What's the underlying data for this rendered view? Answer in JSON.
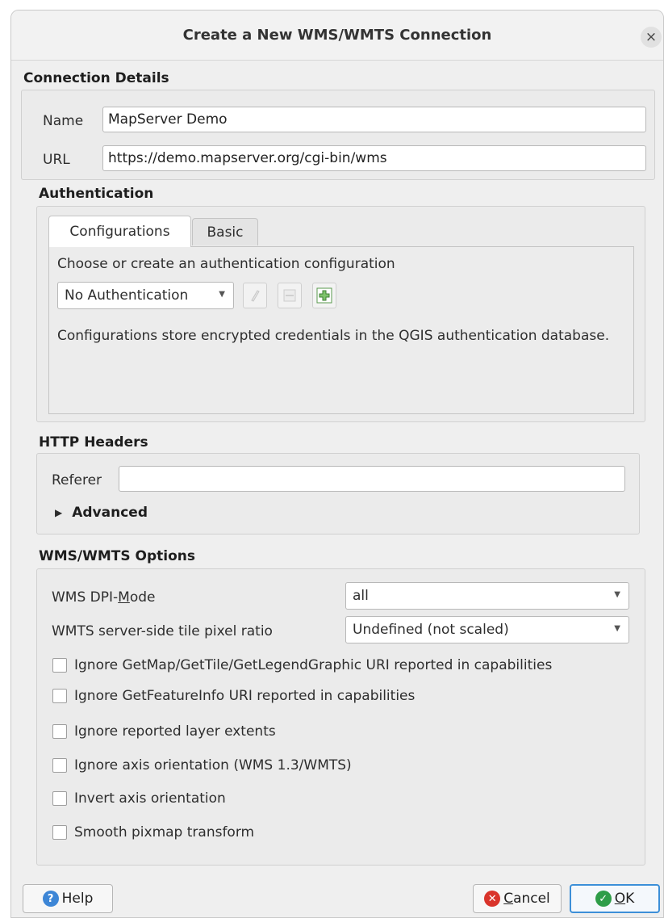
{
  "dialog": {
    "title": "Create a New WMS/WMTS Connection",
    "close_label": "×"
  },
  "connection": {
    "section": "Connection Details",
    "name_label": "Name",
    "name_value": "MapServer Demo",
    "url_label": "URL",
    "url_value": "https://demo.mapserver.org/cgi-bin/wms"
  },
  "auth": {
    "section": "Authentication",
    "tabs": [
      {
        "label": "Configurations",
        "active": true
      },
      {
        "label": "Basic",
        "active": false
      }
    ],
    "prompt": "Choose or create an authentication configuration",
    "selected": "No Authentication",
    "info": "Configurations store encrypted credentials in the QGIS authentication database."
  },
  "http": {
    "section": "HTTP Headers",
    "referer_label": "Referer",
    "referer_value": "",
    "advanced_label": "Advanced"
  },
  "wms": {
    "section": "WMS/WMTS Options",
    "dpi_label_pre": "WMS DPI-",
    "dpi_label_mnemonic": "M",
    "dpi_label_post": "ode",
    "dpi_value": "all",
    "tile_ratio_label": "WMTS server-side tile pixel ratio",
    "tile_ratio_value": "Undefined (not scaled)",
    "options": [
      {
        "label": "Ignore GetMap/GetTile/GetLegendGraphic URI reported in capabilities",
        "checked": false
      },
      {
        "label": "Ignore GetFeatureInfo URI reported in capabilities",
        "checked": false
      },
      {
        "label": "Ignore reported layer extents",
        "checked": false
      },
      {
        "label": "Ignore axis orientation (WMS 1.3/WMTS)",
        "checked": false
      },
      {
        "label": "Invert axis orientation",
        "checked": false
      },
      {
        "label": "Smooth pixmap transform",
        "checked": false
      }
    ]
  },
  "buttons": {
    "help": "Help",
    "cancel_mnemonic": "C",
    "cancel_rest": "ancel",
    "ok_mnemonic": "O",
    "ok_rest": "K"
  },
  "colors": {
    "help_icon": "#3d86d6",
    "cancel_icon": "#d9342b",
    "ok_icon": "#2e9d48",
    "default_button_border": "#3c8fd8"
  },
  "icons": {
    "close": "close-icon",
    "dropdown": "chevron-down-icon",
    "advanced": "triangle-right-icon",
    "edit": "pencil-icon",
    "remove": "minus-icon",
    "add": "plus-icon",
    "help": "help-icon",
    "cancel": "cancel-icon",
    "ok": "check-icon"
  }
}
